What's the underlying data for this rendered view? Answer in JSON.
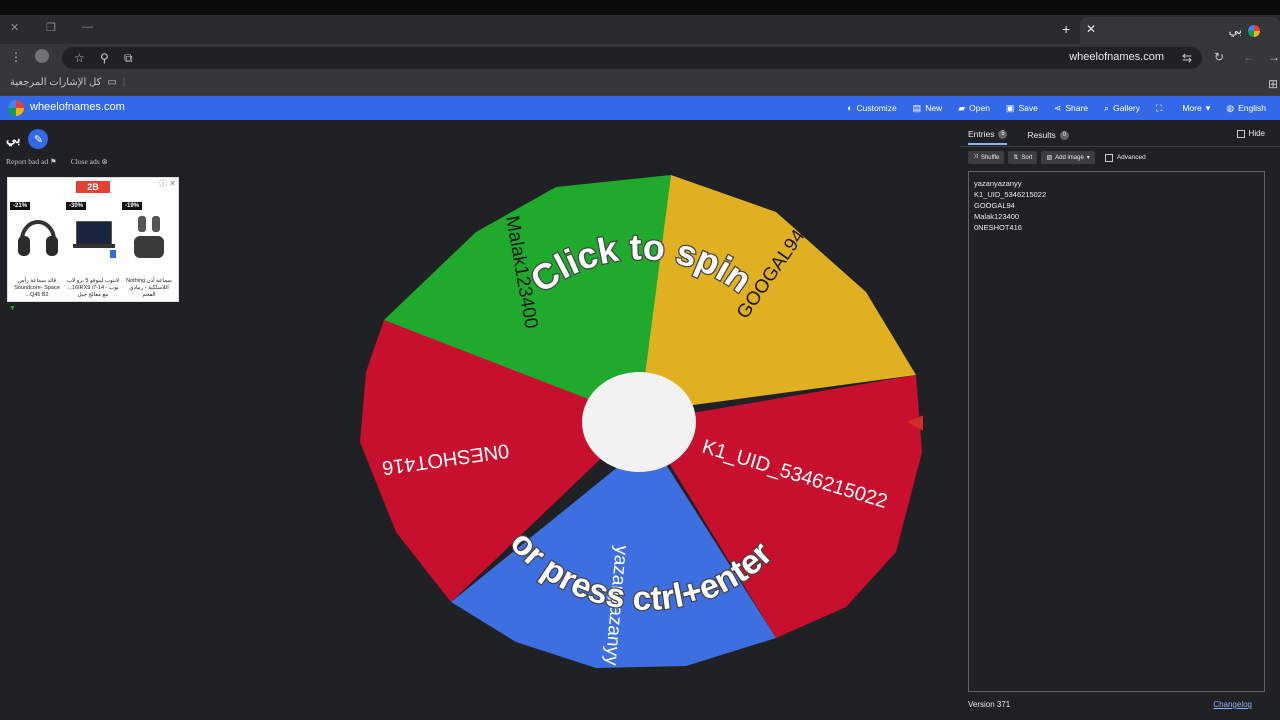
{
  "browser": {
    "tab_title": "بي",
    "url": "wheelofnames.com",
    "bookmarks_label": "كل الإشارات المرجعية"
  },
  "site": {
    "name": "wheelofnames.com",
    "nav": [
      {
        "label": "Customize",
        "icon": "palette-icon",
        "glyph": "◐"
      },
      {
        "label": "New",
        "icon": "file-icon",
        "glyph": "▤"
      },
      {
        "label": "Open",
        "icon": "folder-icon",
        "glyph": "▰"
      },
      {
        "label": "Save",
        "icon": "save-icon",
        "glyph": "▣"
      },
      {
        "label": "Share",
        "icon": "share-icon",
        "glyph": "⋖"
      },
      {
        "label": "Gallery",
        "icon": "search-icon",
        "glyph": "⌕"
      },
      {
        "label": "",
        "icon": "fullscreen-icon",
        "glyph": "⛶"
      },
      {
        "label": "More",
        "icon": "chevron-down-icon",
        "glyph": "▾"
      },
      {
        "label": "English",
        "icon": "globe-icon",
        "glyph": "◍"
      }
    ]
  },
  "left": {
    "wheel_title": "بي",
    "report_ad": "Report bad ad",
    "close_ads": "Close ads",
    "ad_products": [
      {
        "discount": "-21%",
        "caption": "قائد سماعة رأس Soundcore- Space Q45 B2..."
      },
      {
        "discount": "-30%",
        "caption": "لابتوب لينوفو 5 برو لاب توب - 16IRX9 i7-14... مع معالج جيل"
      },
      {
        "discount": "-19%",
        "caption": "سماعة أذن Nothing اللاسلكية - رمادي الفحم"
      }
    ]
  },
  "wheel": {
    "prompt_line1": "Click to spin",
    "prompt_line2": "or press ctrl+enter",
    "colors": {
      "red": "#c8102e",
      "yellow": "#e0b020",
      "green": "#1faa2e",
      "blue": "#3e6fe0",
      "pointer": "#d42a2a"
    }
  },
  "panel": {
    "tab_entries": "Entries",
    "entries_count": "5",
    "tab_results": "Results",
    "results_count": "0",
    "hide_label": "Hide",
    "shuffle": "Shuffle",
    "sort": "Sort",
    "add_image": "Add image",
    "advanced": "Advanced",
    "entries": [
      "yazanyazanyy",
      "K1_UID_5346215022",
      "GOOGAL94",
      "Malak123400",
      "0NESHOT416"
    ],
    "version": "Version 371",
    "changelog": "Changelog"
  }
}
